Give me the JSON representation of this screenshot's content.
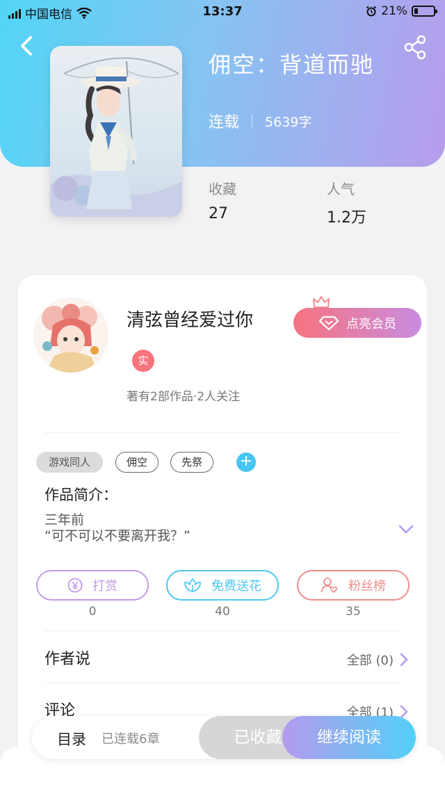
{
  "status_bar": {
    "carrier": "中国电信",
    "time": "13:37",
    "battery_percent": "21%",
    "battery_level": 0.21
  },
  "book": {
    "title": "佣空：背道而驰",
    "status": "连载",
    "word_count": "5639字",
    "stats": [
      {
        "label": "收藏",
        "value": "27"
      },
      {
        "label": "人气",
        "value": "1.2万"
      }
    ]
  },
  "author": {
    "name": "清弦曾经爱过你",
    "badge": "实",
    "meta": "著有2部作品·2人关注",
    "vip_label": "点亮会员"
  },
  "tags": [
    "游戏同人",
    "佣空",
    "先祭"
  ],
  "tag_add_label": "+",
  "intro": {
    "title": "作品简介：",
    "lines": [
      "三年前",
      "“可不可以不要离开我？”"
    ]
  },
  "actions": [
    {
      "label": "打赏",
      "count": "0",
      "icon": "yen-coin-icon",
      "color": "#c29ae8"
    },
    {
      "label": "免费送花",
      "count": "40",
      "icon": "flower-icon",
      "color": "#4cc8f0"
    },
    {
      "label": "粉丝榜",
      "count": "35",
      "icon": "fan-user-icon",
      "color": "#ef8c8c"
    }
  ],
  "author_says": {
    "title": "作者说",
    "more": "全部 (0)"
  },
  "comments": {
    "title": "评论",
    "more": "全部 (1)"
  },
  "bottom_bar": {
    "toc_label": "目录",
    "toc_info": "已连载6章",
    "favorited_label": "已收藏",
    "read_label": "继续阅读"
  },
  "colors": {
    "header_gradient_start": "#52d5f6",
    "header_gradient_end": "#b79cec",
    "vip_gradient_start": "#f7737e",
    "vip_gradient_end": "#c88ce0",
    "accent_blue": "#48c6f2",
    "accent_purple": "#b49aee"
  }
}
